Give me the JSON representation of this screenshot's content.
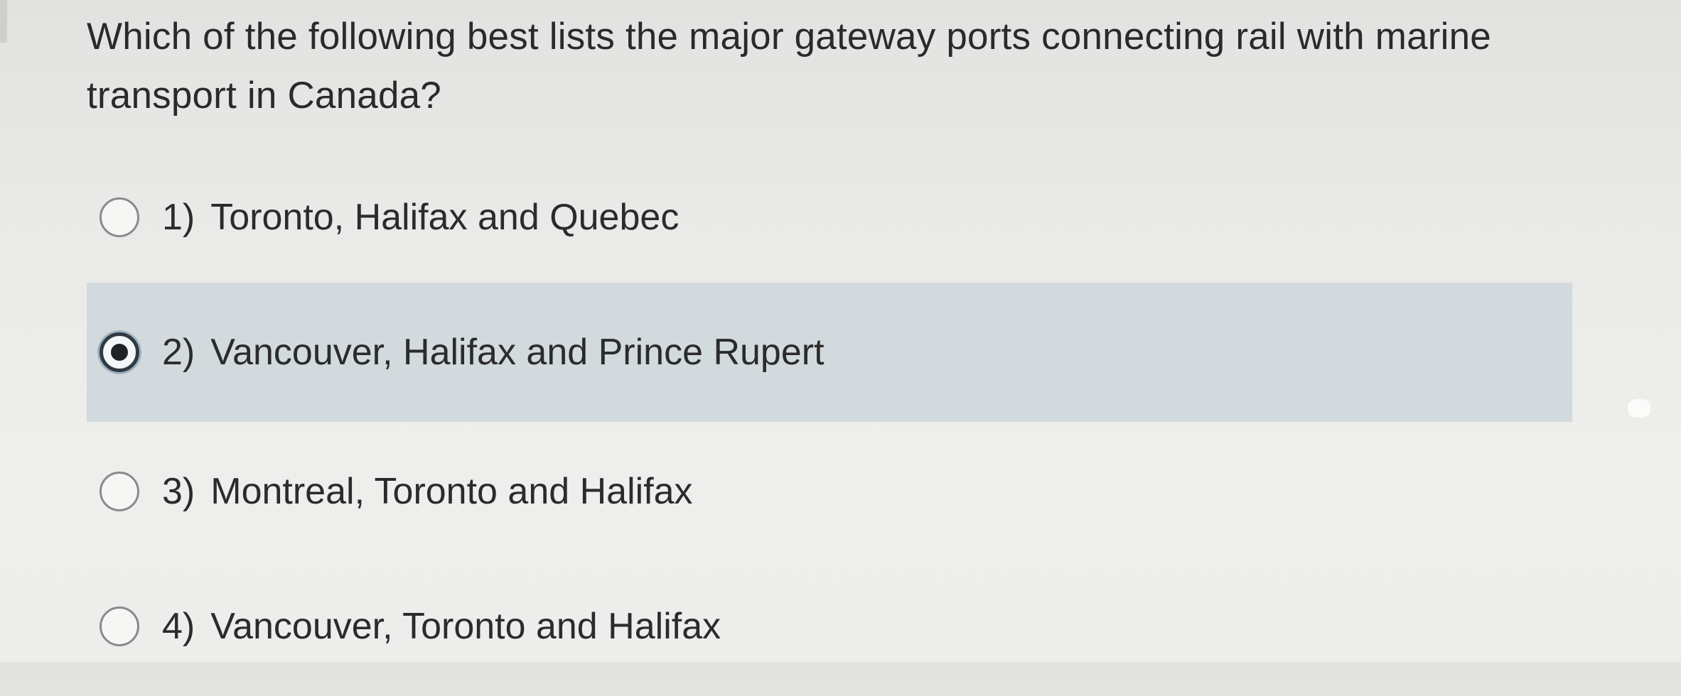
{
  "question": {
    "text": "Which of the following best lists the major gateway ports connecting rail with marine transport in Canada?"
  },
  "options": [
    {
      "number": "1)",
      "label": "Toronto, Halifax and Quebec",
      "selected": false
    },
    {
      "number": "2)",
      "label": "Vancouver, Halifax and Prince Rupert",
      "selected": true
    },
    {
      "number": "3)",
      "label": "Montreal, Toronto and Halifax",
      "selected": false
    },
    {
      "number": "4)",
      "label": "Vancouver, Toronto and Halifax",
      "selected": false
    }
  ],
  "colors": {
    "selected_background": "#d2dadd",
    "text": "#2b2b2b",
    "radio_border": "#8a8a8a",
    "radio_checked": "#1f2328"
  }
}
